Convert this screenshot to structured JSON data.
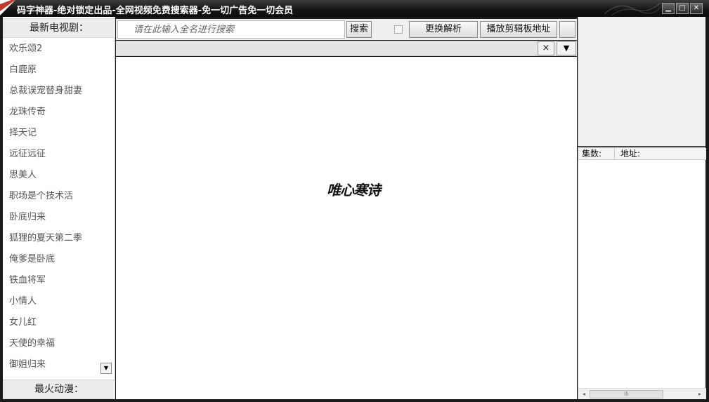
{
  "window": {
    "title": "码字神器-绝对锁定出品-全网视频免费搜索器-免一切广告免一切会员",
    "min_glyph": "▁",
    "max_glyph": "□",
    "close_glyph": "✕"
  },
  "sidebar": {
    "tv_header": "最新电视剧：",
    "anime_header": "最火动漫：",
    "scroll_glyph": "▼",
    "tv_items": [
      "欢乐颂2",
      "白鹿原",
      "总裁误宠替身甜妻",
      "龙珠传奇",
      "择天记",
      "远征远征",
      "思美人",
      "职场是个技术活",
      "卧底归来",
      "狐狸的夏天第二季",
      "俺爹是卧底",
      "铁血将军",
      "小情人",
      "女儿红",
      "天使的幸福",
      "御姐归来"
    ]
  },
  "toolbar": {
    "search_placeholder": "请在此输入全名进行搜索",
    "search_label": "搜索",
    "switch_label": "更换解析",
    "play_label": "播放剪辑板地址",
    "extra_label": ""
  },
  "urlbar": {
    "value": "",
    "clear_glyph": "×",
    "dropdown_glyph": "▼"
  },
  "player": {
    "watermark": "唯心寒诗"
  },
  "episode_list": {
    "col_episode": "集数:",
    "col_address": "地址:",
    "scroll_left": "◂",
    "scroll_right": "▸",
    "scroll_thumb": "III"
  },
  "colors": {
    "titlebar": "#141414",
    "panel": "#f0f0f0",
    "accent_red": "#c0392b"
  },
  "icons": {
    "app": "app-logo-icon",
    "minimize": "minimize-icon",
    "maximize": "maximize-icon",
    "close": "close-icon",
    "clear": "clear-icon",
    "dropdown": "dropdown-arrow-icon"
  }
}
